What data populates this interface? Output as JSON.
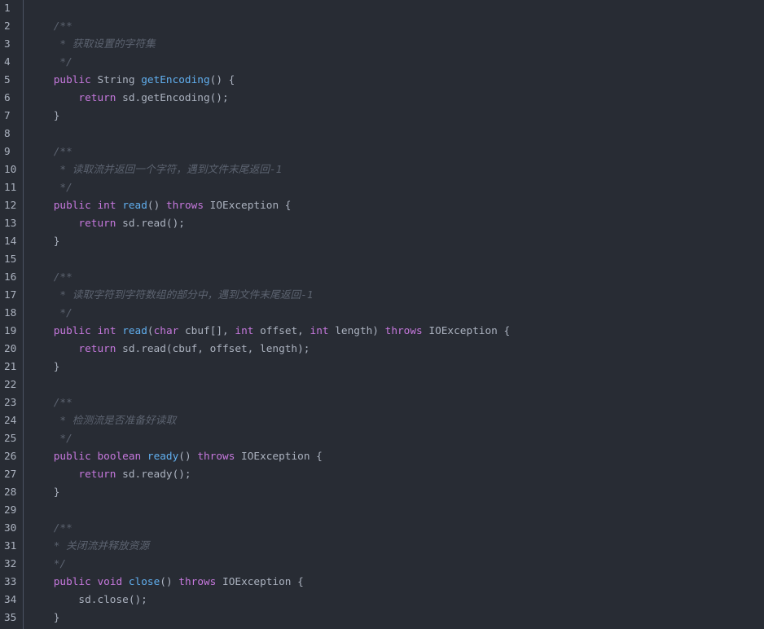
{
  "theme": {
    "background": "#282c34",
    "text": "#abb2bf",
    "line_number": "#abb2bf",
    "keyword": "#c678dd",
    "function": "#61afef",
    "comment": "#5c6370",
    "gutter_border": "#4b5263"
  },
  "code": {
    "lines": [
      {
        "num": 1,
        "tokens": []
      },
      {
        "num": 2,
        "tokens": [
          {
            "text": "    "
          },
          {
            "comment": "/**"
          }
        ]
      },
      {
        "num": 3,
        "tokens": [
          {
            "text": "    "
          },
          {
            "comment": " * 获取设置的字符集"
          }
        ]
      },
      {
        "num": 4,
        "tokens": [
          {
            "text": "    "
          },
          {
            "comment": " */"
          }
        ]
      },
      {
        "num": 5,
        "tokens": [
          {
            "text": "    "
          },
          {
            "keyword": "public"
          },
          {
            "text": " String "
          },
          {
            "function": "getEncoding"
          },
          {
            "text": "() {"
          }
        ]
      },
      {
        "num": 6,
        "tokens": [
          {
            "text": "        "
          },
          {
            "keyword": "return"
          },
          {
            "text": " sd.getEncoding();"
          }
        ]
      },
      {
        "num": 7,
        "tokens": [
          {
            "text": "    }"
          }
        ]
      },
      {
        "num": 8,
        "tokens": []
      },
      {
        "num": 9,
        "tokens": [
          {
            "text": "    "
          },
          {
            "comment": "/**"
          }
        ]
      },
      {
        "num": 10,
        "tokens": [
          {
            "text": "    "
          },
          {
            "comment": " * 读取流并返回一个字符，遇到文件末尾返回-1"
          }
        ]
      },
      {
        "num": 11,
        "tokens": [
          {
            "text": "    "
          },
          {
            "comment": " */"
          }
        ]
      },
      {
        "num": 12,
        "tokens": [
          {
            "text": "    "
          },
          {
            "keyword": "public"
          },
          {
            "text": " "
          },
          {
            "keyword": "int"
          },
          {
            "text": " "
          },
          {
            "function": "read"
          },
          {
            "text": "() "
          },
          {
            "keyword": "throws"
          },
          {
            "text": " IOException {"
          }
        ]
      },
      {
        "num": 13,
        "tokens": [
          {
            "text": "        "
          },
          {
            "keyword": "return"
          },
          {
            "text": " sd.read();"
          }
        ]
      },
      {
        "num": 14,
        "tokens": [
          {
            "text": "    }"
          }
        ]
      },
      {
        "num": 15,
        "tokens": []
      },
      {
        "num": 16,
        "tokens": [
          {
            "text": "    "
          },
          {
            "comment": "/**"
          }
        ]
      },
      {
        "num": 17,
        "tokens": [
          {
            "text": "    "
          },
          {
            "comment": " * 读取字符到字符数组的部分中，遇到文件末尾返回-1"
          }
        ]
      },
      {
        "num": 18,
        "tokens": [
          {
            "text": "    "
          },
          {
            "comment": " */"
          }
        ]
      },
      {
        "num": 19,
        "tokens": [
          {
            "text": "    "
          },
          {
            "keyword": "public"
          },
          {
            "text": " "
          },
          {
            "keyword": "int"
          },
          {
            "text": " "
          },
          {
            "function": "read"
          },
          {
            "text": "("
          },
          {
            "keyword": "char"
          },
          {
            "text": " cbuf[], "
          },
          {
            "keyword": "int"
          },
          {
            "text": " offset, "
          },
          {
            "keyword": "int"
          },
          {
            "text": " length) "
          },
          {
            "keyword": "throws"
          },
          {
            "text": " IOException {"
          }
        ]
      },
      {
        "num": 20,
        "tokens": [
          {
            "text": "        "
          },
          {
            "keyword": "return"
          },
          {
            "text": " sd.read(cbuf, offset, length);"
          }
        ]
      },
      {
        "num": 21,
        "tokens": [
          {
            "text": "    }"
          }
        ]
      },
      {
        "num": 22,
        "tokens": []
      },
      {
        "num": 23,
        "tokens": [
          {
            "text": "    "
          },
          {
            "comment": "/**"
          }
        ]
      },
      {
        "num": 24,
        "tokens": [
          {
            "text": "    "
          },
          {
            "comment": " * 检测流是否准备好读取"
          }
        ]
      },
      {
        "num": 25,
        "tokens": [
          {
            "text": "    "
          },
          {
            "comment": " */"
          }
        ]
      },
      {
        "num": 26,
        "tokens": [
          {
            "text": "    "
          },
          {
            "keyword": "public"
          },
          {
            "text": " "
          },
          {
            "keyword": "boolean"
          },
          {
            "text": " "
          },
          {
            "function": "ready"
          },
          {
            "text": "() "
          },
          {
            "keyword": "throws"
          },
          {
            "text": " IOException {"
          }
        ]
      },
      {
        "num": 27,
        "tokens": [
          {
            "text": "        "
          },
          {
            "keyword": "return"
          },
          {
            "text": " sd.ready();"
          }
        ]
      },
      {
        "num": 28,
        "tokens": [
          {
            "text": "    }"
          }
        ]
      },
      {
        "num": 29,
        "tokens": []
      },
      {
        "num": 30,
        "tokens": [
          {
            "text": "    "
          },
          {
            "comment": "/**"
          }
        ]
      },
      {
        "num": 31,
        "tokens": [
          {
            "text": "    "
          },
          {
            "comment": "* 关闭流并释放资源"
          }
        ]
      },
      {
        "num": 32,
        "tokens": [
          {
            "text": "    "
          },
          {
            "comment": "*/"
          }
        ]
      },
      {
        "num": 33,
        "tokens": [
          {
            "text": "    "
          },
          {
            "keyword": "public"
          },
          {
            "text": " "
          },
          {
            "keyword": "void"
          },
          {
            "text": " "
          },
          {
            "function": "close"
          },
          {
            "text": "() "
          },
          {
            "keyword": "throws"
          },
          {
            "text": " IOException {"
          }
        ]
      },
      {
        "num": 34,
        "tokens": [
          {
            "text": "        sd.close();"
          }
        ]
      },
      {
        "num": 35,
        "tokens": [
          {
            "text": "    }"
          }
        ]
      }
    ]
  }
}
